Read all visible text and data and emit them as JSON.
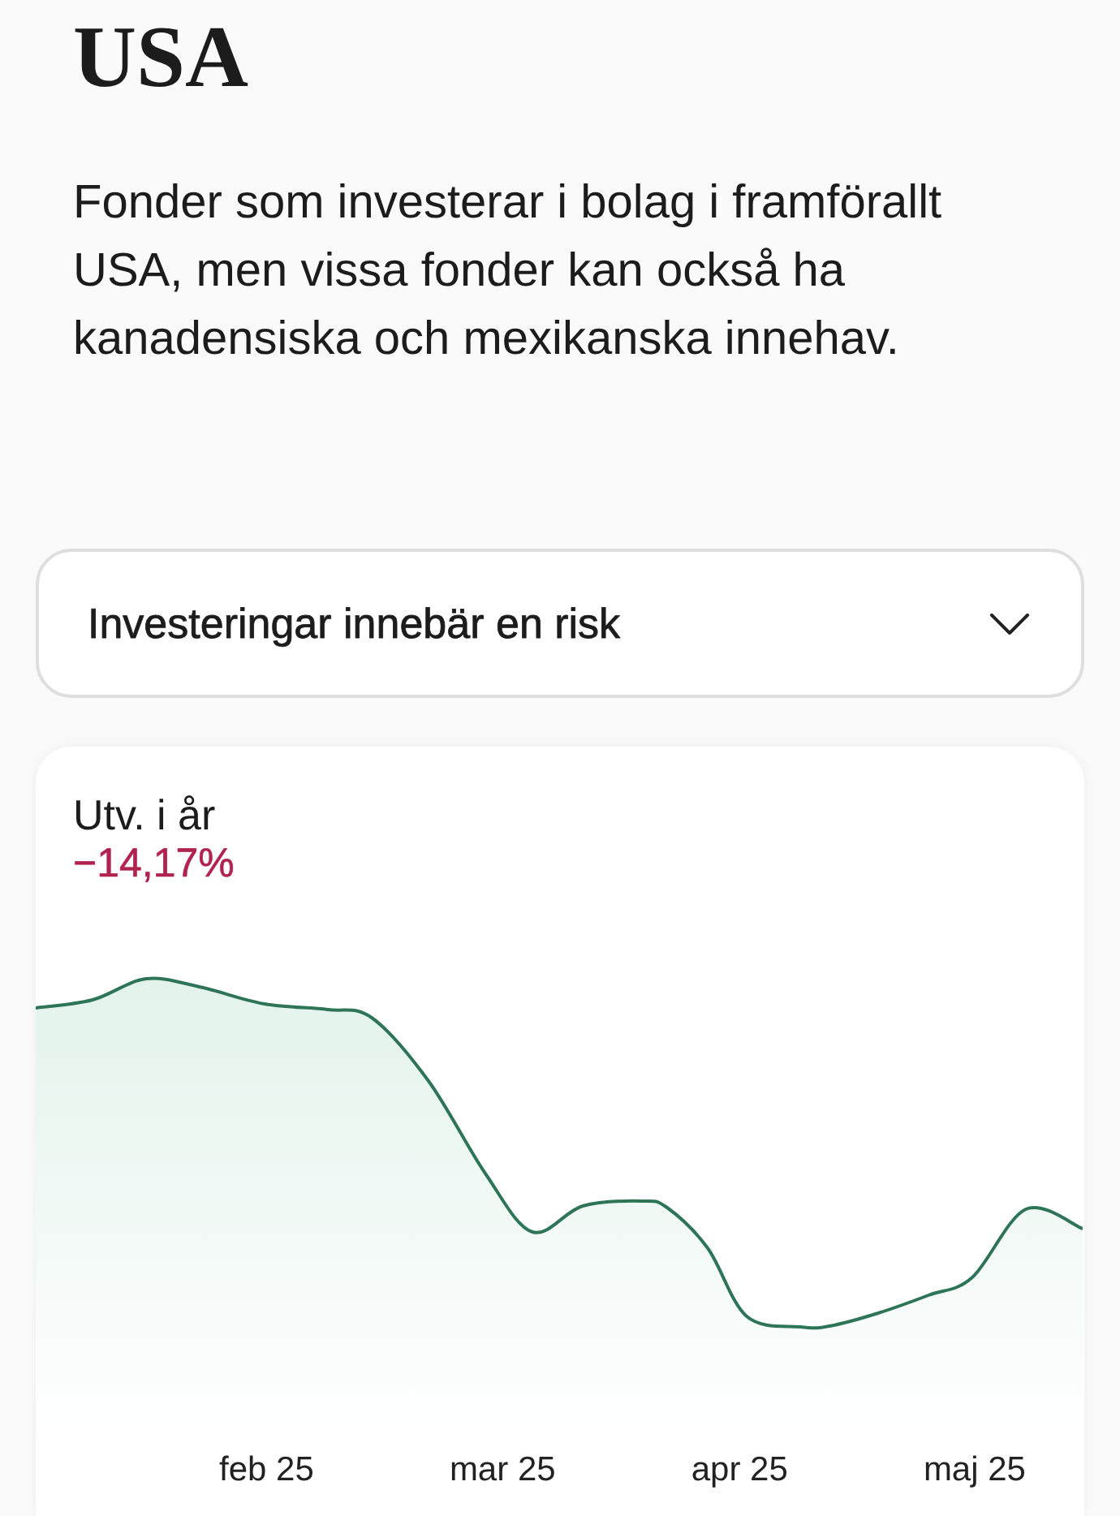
{
  "header": {
    "title": "USA",
    "description": "Fonder som investerar i bolag i framförallt USA, men vissa fonder kan också ha kanadensiska och mexikanska innehav."
  },
  "risk_disclosure": {
    "label": "Investeringar innebär en risk",
    "expanded": false
  },
  "performance": {
    "label": "Utv. i år",
    "value": "−14,17%",
    "negative": true,
    "x_labels": [
      "feb 25",
      "mar 25",
      "apr 25",
      "maj 25"
    ]
  }
}
